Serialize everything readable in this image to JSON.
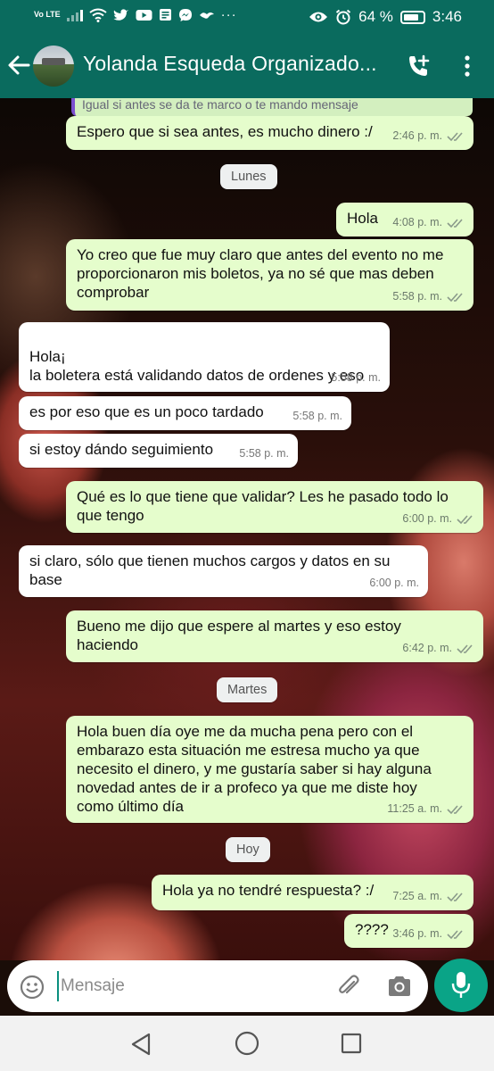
{
  "status_bar": {
    "network": "Vo LTE",
    "battery_percent": "64 %",
    "time": "3:46"
  },
  "header": {
    "title": "Yolanda Esqueda Organizado..."
  },
  "quoted_preview": "Igual si antes se da te marco o te mando mensaje",
  "messages": [
    {
      "direction": "out",
      "text": "Espero que si sea antes, es mucho dinero :/",
      "time": "2:46 p. m.",
      "ticks": true
    },
    {
      "direction": "out",
      "text": "Hola",
      "time": "4:08 p. m.",
      "ticks": true
    },
    {
      "direction": "out",
      "text": "Yo creo que fue muy claro que antes del evento no me proporcionaron mis boletos, ya no sé que mas deben comprobar",
      "time": "5:58 p. m.",
      "ticks": true
    },
    {
      "direction": "in",
      "text": "Hola¡\nla boletera está validando datos de ordenes y eso",
      "time": "5:58 p. m.",
      "ticks": false
    },
    {
      "direction": "in",
      "text": "es por eso que es un poco tardado",
      "time": "5:58 p. m.",
      "ticks": false
    },
    {
      "direction": "in",
      "text": "si estoy dándo seguimiento",
      "time": "5:58 p. m.",
      "ticks": false
    },
    {
      "direction": "out",
      "text": "Qué es lo que tiene que validar? Les he pasado todo lo que tengo",
      "time": "6:00 p. m.",
      "ticks": true
    },
    {
      "direction": "in",
      "text": "si claro, sólo que tienen muchos cargos y datos en su base",
      "time": "6:00 p. m.",
      "ticks": false
    },
    {
      "direction": "out",
      "text": "Bueno me dijo que espere al martes y eso estoy haciendo",
      "time": "6:42 p. m.",
      "ticks": true
    },
    {
      "direction": "out",
      "text": "Hola buen día oye me da mucha pena pero con el embarazo esta situación me estresa mucho ya que necesito el dinero, y me gustaría saber si hay alguna novedad antes de ir a profeco ya que me diste hoy como último día",
      "time": "11:25 a. m.",
      "ticks": true
    },
    {
      "direction": "out",
      "text": "Hola ya no tendré respuesta? :/",
      "time": "7:25 a. m.",
      "ticks": true
    },
    {
      "direction": "out",
      "text": "????",
      "time": "3:46 p. m.",
      "ticks": true
    }
  ],
  "day_separators": [
    "Lunes",
    "Martes",
    "Hoy"
  ],
  "composer": {
    "placeholder": "Mensaje"
  },
  "colors": {
    "header": "#0a6b5e",
    "outgoing_bubble": "#e5fdcc",
    "incoming_bubble": "#ffffff",
    "mic_button": "#0aa487",
    "ticks": "#8a9a8a"
  }
}
